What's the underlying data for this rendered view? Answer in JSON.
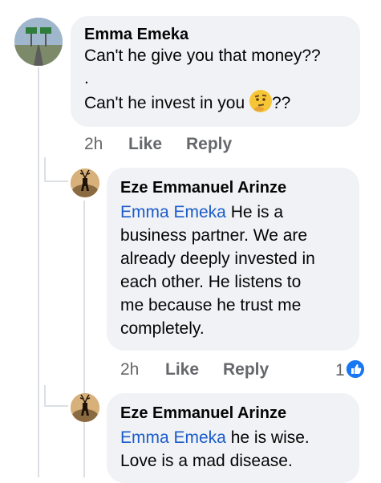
{
  "comments": [
    {
      "author": "Emma Emeka",
      "lines": [
        "Can't he give you that money??",
        ".",
        "Can't he invest in you",
        "??"
      ],
      "emoji": "thinking-face-icon",
      "time": "2h",
      "like_label": "Like",
      "reply_label": "Reply"
    },
    {
      "author": "Eze Emmanuel Arinze",
      "mention": "Emma Emeka",
      "lines": [
        " He is a",
        "business partner. We are",
        "already deeply invested in",
        "each other. He listens to",
        "me because he trust me",
        "completely."
      ],
      "time": "2h",
      "like_label": "Like",
      "reply_label": "Reply",
      "reaction_count": "1",
      "reaction_icon": "thumbs-up-badge-icon"
    },
    {
      "author": "Eze Emmanuel Arinze",
      "mention": "Emma Emeka",
      "lines": [
        " he is wise.",
        "Love is a mad disease."
      ]
    }
  ],
  "colors": {
    "bubble": "#f0f2f5",
    "mention": "#1b5cc9",
    "meta": "#65676b",
    "like_badge": "#1877f2"
  }
}
